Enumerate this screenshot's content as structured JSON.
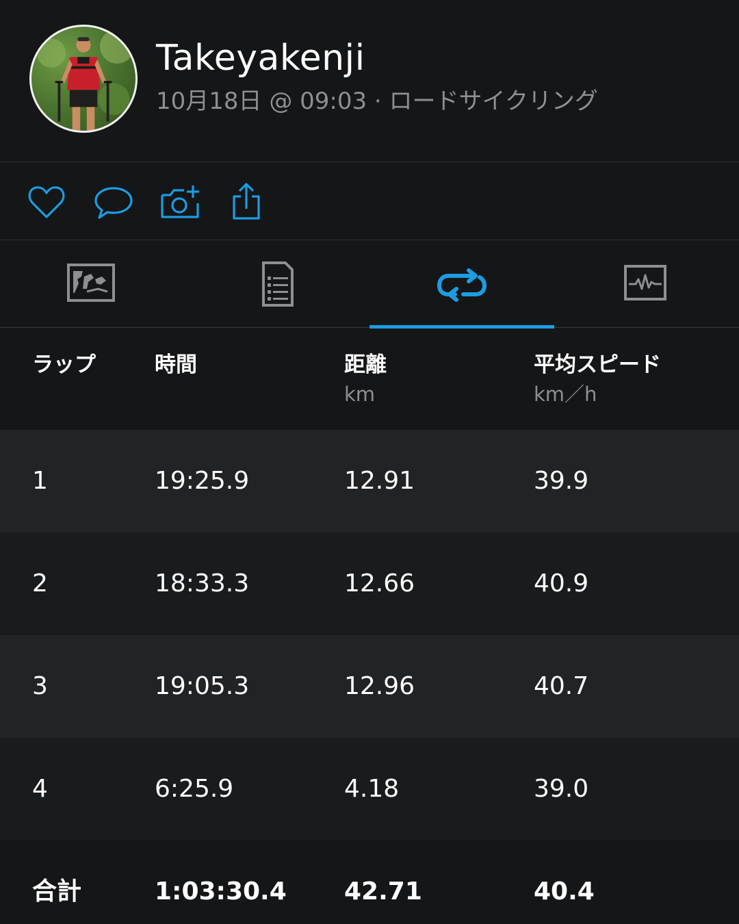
{
  "header": {
    "user_name": "Takeyakenji",
    "meta": "10月18日 @ 09:03 · ロードサイクリング"
  },
  "actions": [
    {
      "icon": "heart-icon"
    },
    {
      "icon": "comment-icon"
    },
    {
      "icon": "add-photo-icon"
    },
    {
      "icon": "share-icon"
    }
  ],
  "tabs": [
    {
      "icon": "map-tab-icon"
    },
    {
      "icon": "stats-tab-icon"
    },
    {
      "icon": "laps-tab-icon",
      "active": true
    },
    {
      "icon": "charts-tab-icon"
    }
  ],
  "colors": {
    "accent": "#1b9de2",
    "background": "#151617",
    "row_light": "#222324",
    "row_dark": "#1a1b1c",
    "muted_text": "#8e8f92"
  },
  "laps_table": {
    "headers": {
      "lap": "ラップ",
      "time": "時間",
      "distance": "距離",
      "distance_unit": "km",
      "avg_speed": "平均スピード",
      "avg_speed_unit": "km／h"
    },
    "rows": [
      {
        "lap": "1",
        "time": "19:25.9",
        "distance": "12.91",
        "speed": "39.9"
      },
      {
        "lap": "2",
        "time": "18:33.3",
        "distance": "12.66",
        "speed": "40.9"
      },
      {
        "lap": "3",
        "time": "19:05.3",
        "distance": "12.96",
        "speed": "40.7"
      },
      {
        "lap": "4",
        "time": "6:25.9",
        "distance": "4.18",
        "speed": "39.0"
      }
    ],
    "total": {
      "label": "合計",
      "time": "1:03:30.4",
      "distance": "42.71",
      "speed": "40.4"
    }
  }
}
